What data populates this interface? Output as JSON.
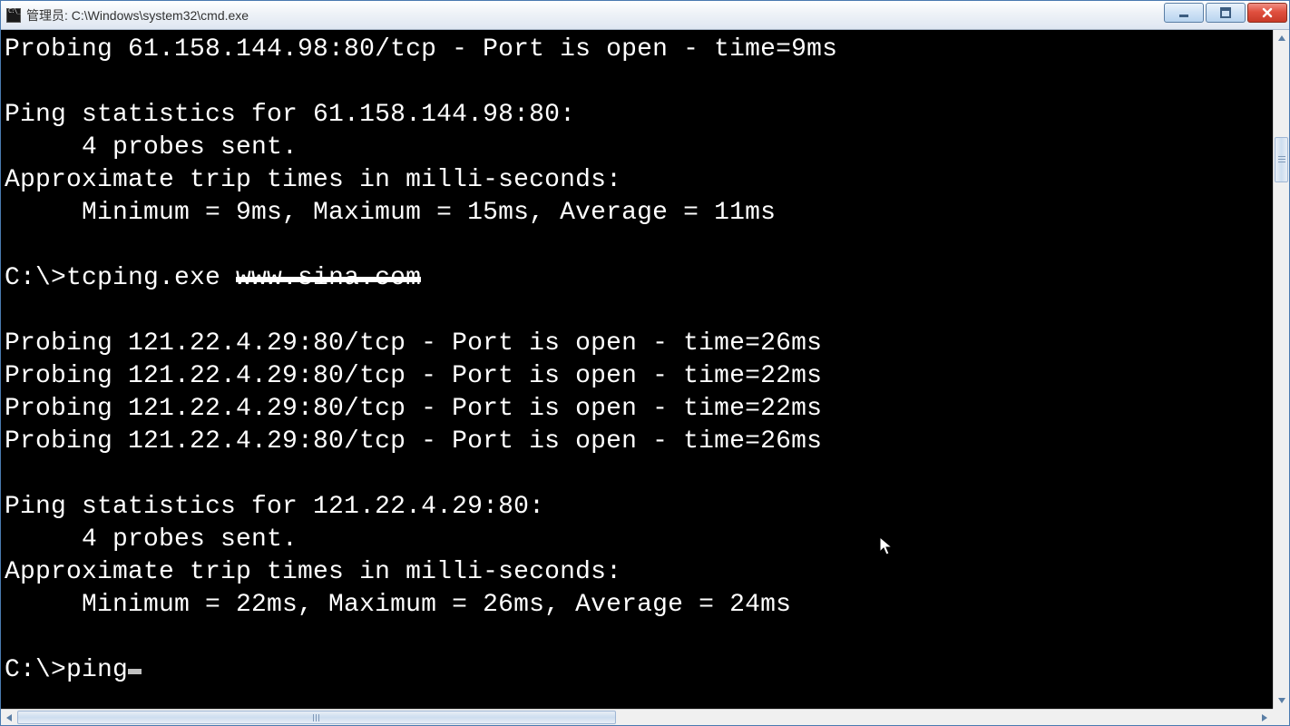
{
  "window": {
    "title": "管理员: C:\\Windows\\system32\\cmd.exe"
  },
  "console": {
    "lines": [
      "Probing 61.158.144.98:80/tcp - Port is open - time=9ms",
      "",
      "Ping statistics for 61.158.144.98:80:",
      "     4 probes sent.",
      "Approximate trip times in milli-seconds:",
      "     Minimum = 9ms, Maximum = 15ms, Average = 11ms",
      "",
      "C:\\>tcping.exe ",
      "",
      "Probing 121.22.4.29:80/tcp - Port is open - time=26ms",
      "Probing 121.22.4.29:80/tcp - Port is open - time=22ms",
      "Probing 121.22.4.29:80/tcp - Port is open - time=22ms",
      "Probing 121.22.4.29:80/tcp - Port is open - time=26ms",
      "",
      "Ping statistics for 121.22.4.29:80:",
      "     4 probes sent.",
      "Approximate trip times in milli-seconds:",
      "     Minimum = 22ms, Maximum = 26ms, Average = 24ms",
      "",
      "C:\\>ping"
    ],
    "redacted_argument": "www.sina.com"
  }
}
